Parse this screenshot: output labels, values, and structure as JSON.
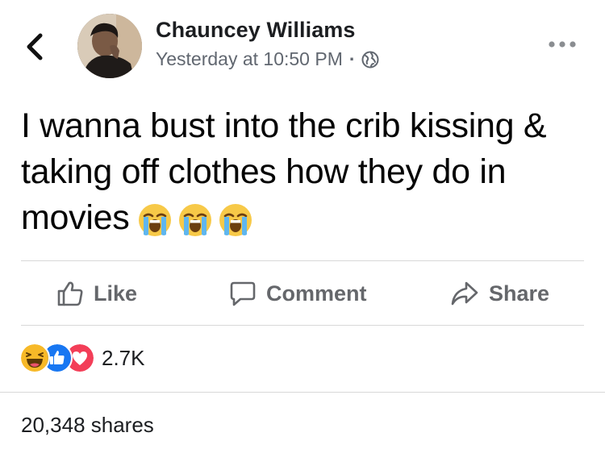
{
  "post": {
    "author": "Chauncey Williams",
    "timestamp": "Yesterday at 10:50 PM",
    "separator": "·",
    "privacy_icon": "globe-icon",
    "text": "I wanna bust into the crib kissing & taking off clothes how they do in movies",
    "emojis": [
      "loudly-crying-face",
      "loudly-crying-face",
      "loudly-crying-face"
    ]
  },
  "actions": {
    "like_label": "Like",
    "comment_label": "Comment",
    "share_label": "Share"
  },
  "engagement": {
    "reaction_icons": [
      "haha-icon",
      "like-icon",
      "love-icon"
    ],
    "reaction_count": "2.7K",
    "shares": "20,348 shares"
  },
  "colors": {
    "text_primary": "#1c1e21",
    "text_secondary": "#65676b",
    "divider": "#d8d8d8",
    "like_blue": "#1877f2",
    "love_red": "#f33e58",
    "haha_yellow": "#f7b928"
  }
}
